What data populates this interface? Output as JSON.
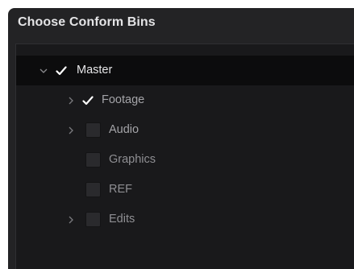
{
  "dialog": {
    "title": "Choose Conform Bins"
  },
  "tree": {
    "root": {
      "label": "Master",
      "checked": true,
      "expanded": true,
      "icon": "chevron-down-icon"
    },
    "children": [
      {
        "label": "Footage",
        "checked": true,
        "has_children": true,
        "icon": "chevron-right-icon"
      },
      {
        "label": "Audio",
        "checked": false,
        "has_children": true,
        "icon": "chevron-right-icon"
      },
      {
        "label": "Graphics",
        "checked": false,
        "has_children": false
      },
      {
        "label": "REF",
        "checked": false,
        "has_children": false
      },
      {
        "label": "Edits",
        "checked": false,
        "has_children": true,
        "icon": "chevron-right-icon"
      }
    ]
  },
  "colors": {
    "dialog_bg": "#232325",
    "panel_bg": "#19191b",
    "selected_row_bg": "#0c0c0d",
    "checkmark": "#ffffff"
  }
}
